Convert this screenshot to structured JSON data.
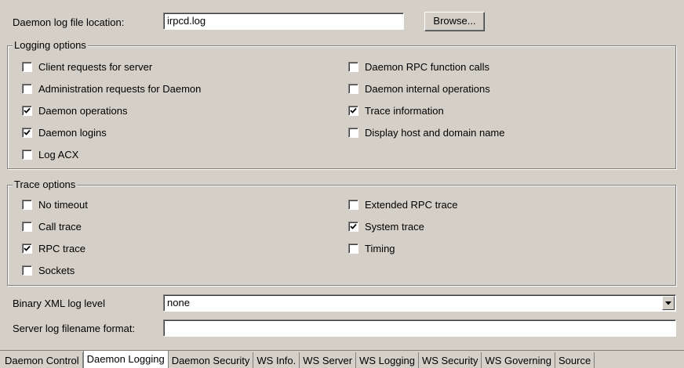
{
  "log_file": {
    "label": "Daemon log file location:",
    "value": "irpcd.log",
    "browse_label": "Browse..."
  },
  "logging_options": {
    "title": "Logging options",
    "items": [
      {
        "label": "Client requests for server",
        "checked": false
      },
      {
        "label": "Administration requests for Daemon",
        "checked": false
      },
      {
        "label": "Daemon operations",
        "checked": true
      },
      {
        "label": "Daemon logins",
        "checked": true
      },
      {
        "label": "Log ACX",
        "checked": false
      },
      {
        "label": "Daemon RPC function calls",
        "checked": false
      },
      {
        "label": "Daemon internal operations",
        "checked": false
      },
      {
        "label": "Trace information",
        "checked": true
      },
      {
        "label": "Display host and domain name",
        "checked": false
      }
    ]
  },
  "trace_options": {
    "title": "Trace options",
    "items": [
      {
        "label": "No timeout",
        "checked": false
      },
      {
        "label": "Call trace",
        "checked": false
      },
      {
        "label": "RPC trace",
        "checked": true
      },
      {
        "label": "Sockets",
        "checked": false
      },
      {
        "label": "Extended RPC trace",
        "checked": false
      },
      {
        "label": "System trace",
        "checked": true
      },
      {
        "label": "Timing",
        "checked": false
      }
    ]
  },
  "binary_xml": {
    "label": "Binary XML log level",
    "value": "none"
  },
  "server_log": {
    "label": "Server log filename format:",
    "value": ""
  },
  "tabs": [
    {
      "label": "Daemon Control",
      "active": false
    },
    {
      "label": "Daemon Logging",
      "active": true
    },
    {
      "label": "Daemon Security",
      "active": false
    },
    {
      "label": "WS Info.",
      "active": false
    },
    {
      "label": "WS Server",
      "active": false
    },
    {
      "label": "WS Logging",
      "active": false
    },
    {
      "label": "WS Security",
      "active": false
    },
    {
      "label": "WS Governing",
      "active": false
    },
    {
      "label": "Source",
      "active": false
    }
  ],
  "colors": {
    "background": "#d4d0c8",
    "field": "#ffffff",
    "shadow": "#808080"
  }
}
